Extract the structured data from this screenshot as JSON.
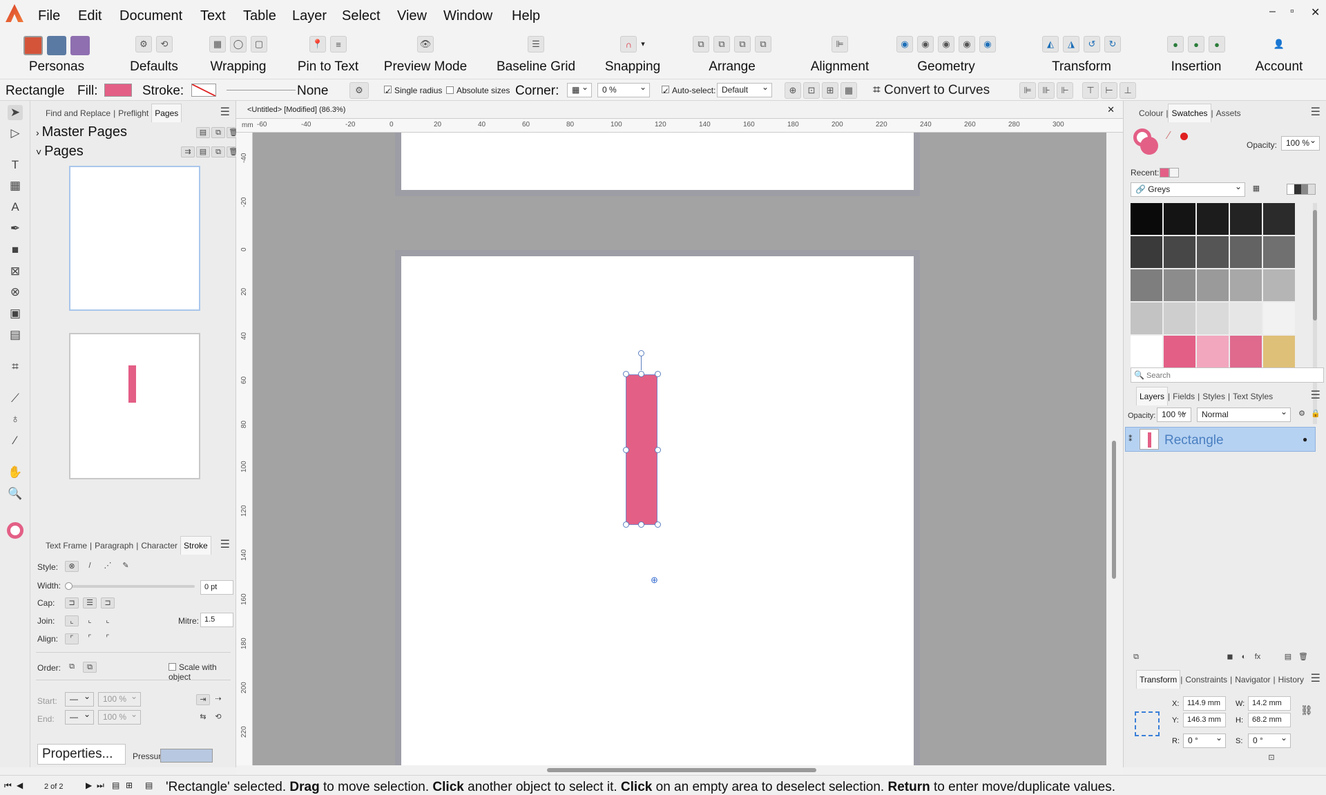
{
  "menu": {
    "items": [
      "File",
      "Edit",
      "Document",
      "Text",
      "Table",
      "Layer",
      "Select",
      "View",
      "Window",
      "Help"
    ]
  },
  "window_controls": {
    "minimize": "–",
    "restore": "▫",
    "close": "✕"
  },
  "toolbar": {
    "personas_label": "Personas",
    "defaults_label": "Defaults",
    "wrapping_label": "Wrapping",
    "pin_label": "Pin to Text",
    "preview_label": "Preview Mode",
    "baseline_label": "Baseline Grid",
    "snapping_label": "Snapping",
    "arrange_label": "Arrange",
    "alignment_label": "Alignment",
    "geometry_label": "Geometry",
    "transform_label": "Transform",
    "insertion_label": "Insertion",
    "account_label": "Account"
  },
  "context": {
    "object_name": "Rectangle",
    "fill_label": "Fill:",
    "fill_color": "#e35f86",
    "stroke_label": "Stroke:",
    "stroke_value": "None",
    "single_radius": "Single radius",
    "absolute_sizes": "Absolute sizes",
    "corner_label": "Corner:",
    "corner_value": "0 %",
    "autoselect_label": "Auto-select:",
    "autoselect_value": "Default",
    "convert_label": "Convert to Curves"
  },
  "left_panel": {
    "tabs": [
      "Find and Replace",
      "Preflight",
      "Pages"
    ],
    "master_pages": "Master Pages",
    "pages": "Pages",
    "bottom_tabs": [
      "Text Frame",
      "Paragraph",
      "Character",
      "Stroke"
    ],
    "stroke": {
      "style_label": "Style:",
      "width_label": "Width:",
      "width_value": "0 pt",
      "cap_label": "Cap:",
      "join_label": "Join:",
      "mitre_label": "Mitre:",
      "mitre_value": "1.5",
      "align_label": "Align:",
      "order_label": "Order:",
      "scale_label": "Scale with object",
      "start_label": "Start:",
      "end_label": "End:",
      "start_pct": "100 %",
      "end_pct": "100 %"
    },
    "properties_button": "Properties...",
    "pressure_label": "Pressure:"
  },
  "document": {
    "tab_title": "<Untitled> [Modified] (86.3%)",
    "ruler_unit": "mm",
    "hruler_ticks": [
      "-60",
      "-40",
      "-20",
      "0",
      "20",
      "40",
      "60",
      "80",
      "100",
      "120",
      "140",
      "160",
      "180",
      "200",
      "220",
      "240",
      "260",
      "280",
      "300"
    ],
    "vruler_ticks": [
      "-40",
      "-20",
      "0",
      "20",
      "40",
      "60",
      "80",
      "100",
      "120",
      "140",
      "160",
      "180",
      "200",
      "220"
    ]
  },
  "right_panel": {
    "top_tabs": [
      "Colour",
      "Swatches",
      "Assets"
    ],
    "opacity_label": "Opacity:",
    "opacity_value": "100 %",
    "recent_label": "Recent:",
    "palette_name": "Greys",
    "swatch_colors": [
      "#0a0a0a",
      "#141414",
      "#1c1c1c",
      "#232323",
      "#2b2b2b",
      "#3a3a3a",
      "#474747",
      "#555555",
      "#636363",
      "#707070",
      "#7e7e7e",
      "#8c8c8c",
      "#9a9a9a",
      "#a8a8a8",
      "#b5b5b5",
      "#c3c3c3",
      "#cecece",
      "#dadada",
      "#e6e6e6",
      "#f2f2f2",
      "#ffffff",
      "#e35f86",
      "#f2a7bf",
      "#df6a8e",
      "#dfc078"
    ],
    "search_placeholder": "Search",
    "layer_tabs": [
      "Layers",
      "Fields",
      "Styles",
      "Text Styles"
    ],
    "layer_opacity_value": "100 %",
    "blend_mode": "Normal",
    "layer_name": "Rectangle",
    "transform_tabs": [
      "Transform",
      "Constraints",
      "Navigator",
      "History"
    ],
    "transform": {
      "x_label": "X:",
      "x": "114.9 mm",
      "y_label": "Y:",
      "y": "146.3 mm",
      "w_label": "W:",
      "w": "14.2 mm",
      "h_label": "H:",
      "h": "68.2 mm",
      "r_label": "R:",
      "r": "0 °",
      "s_label": "S:",
      "s": "0 °"
    }
  },
  "status": {
    "page_indicator": "2 of 2",
    "message_parts": [
      "'Rectangle' selected. ",
      "Drag",
      " to move selection. ",
      "Click",
      " another object to select it. ",
      "Click",
      " on an empty area to deselect selection. ",
      "Return",
      " to enter move/duplicate values."
    ]
  }
}
